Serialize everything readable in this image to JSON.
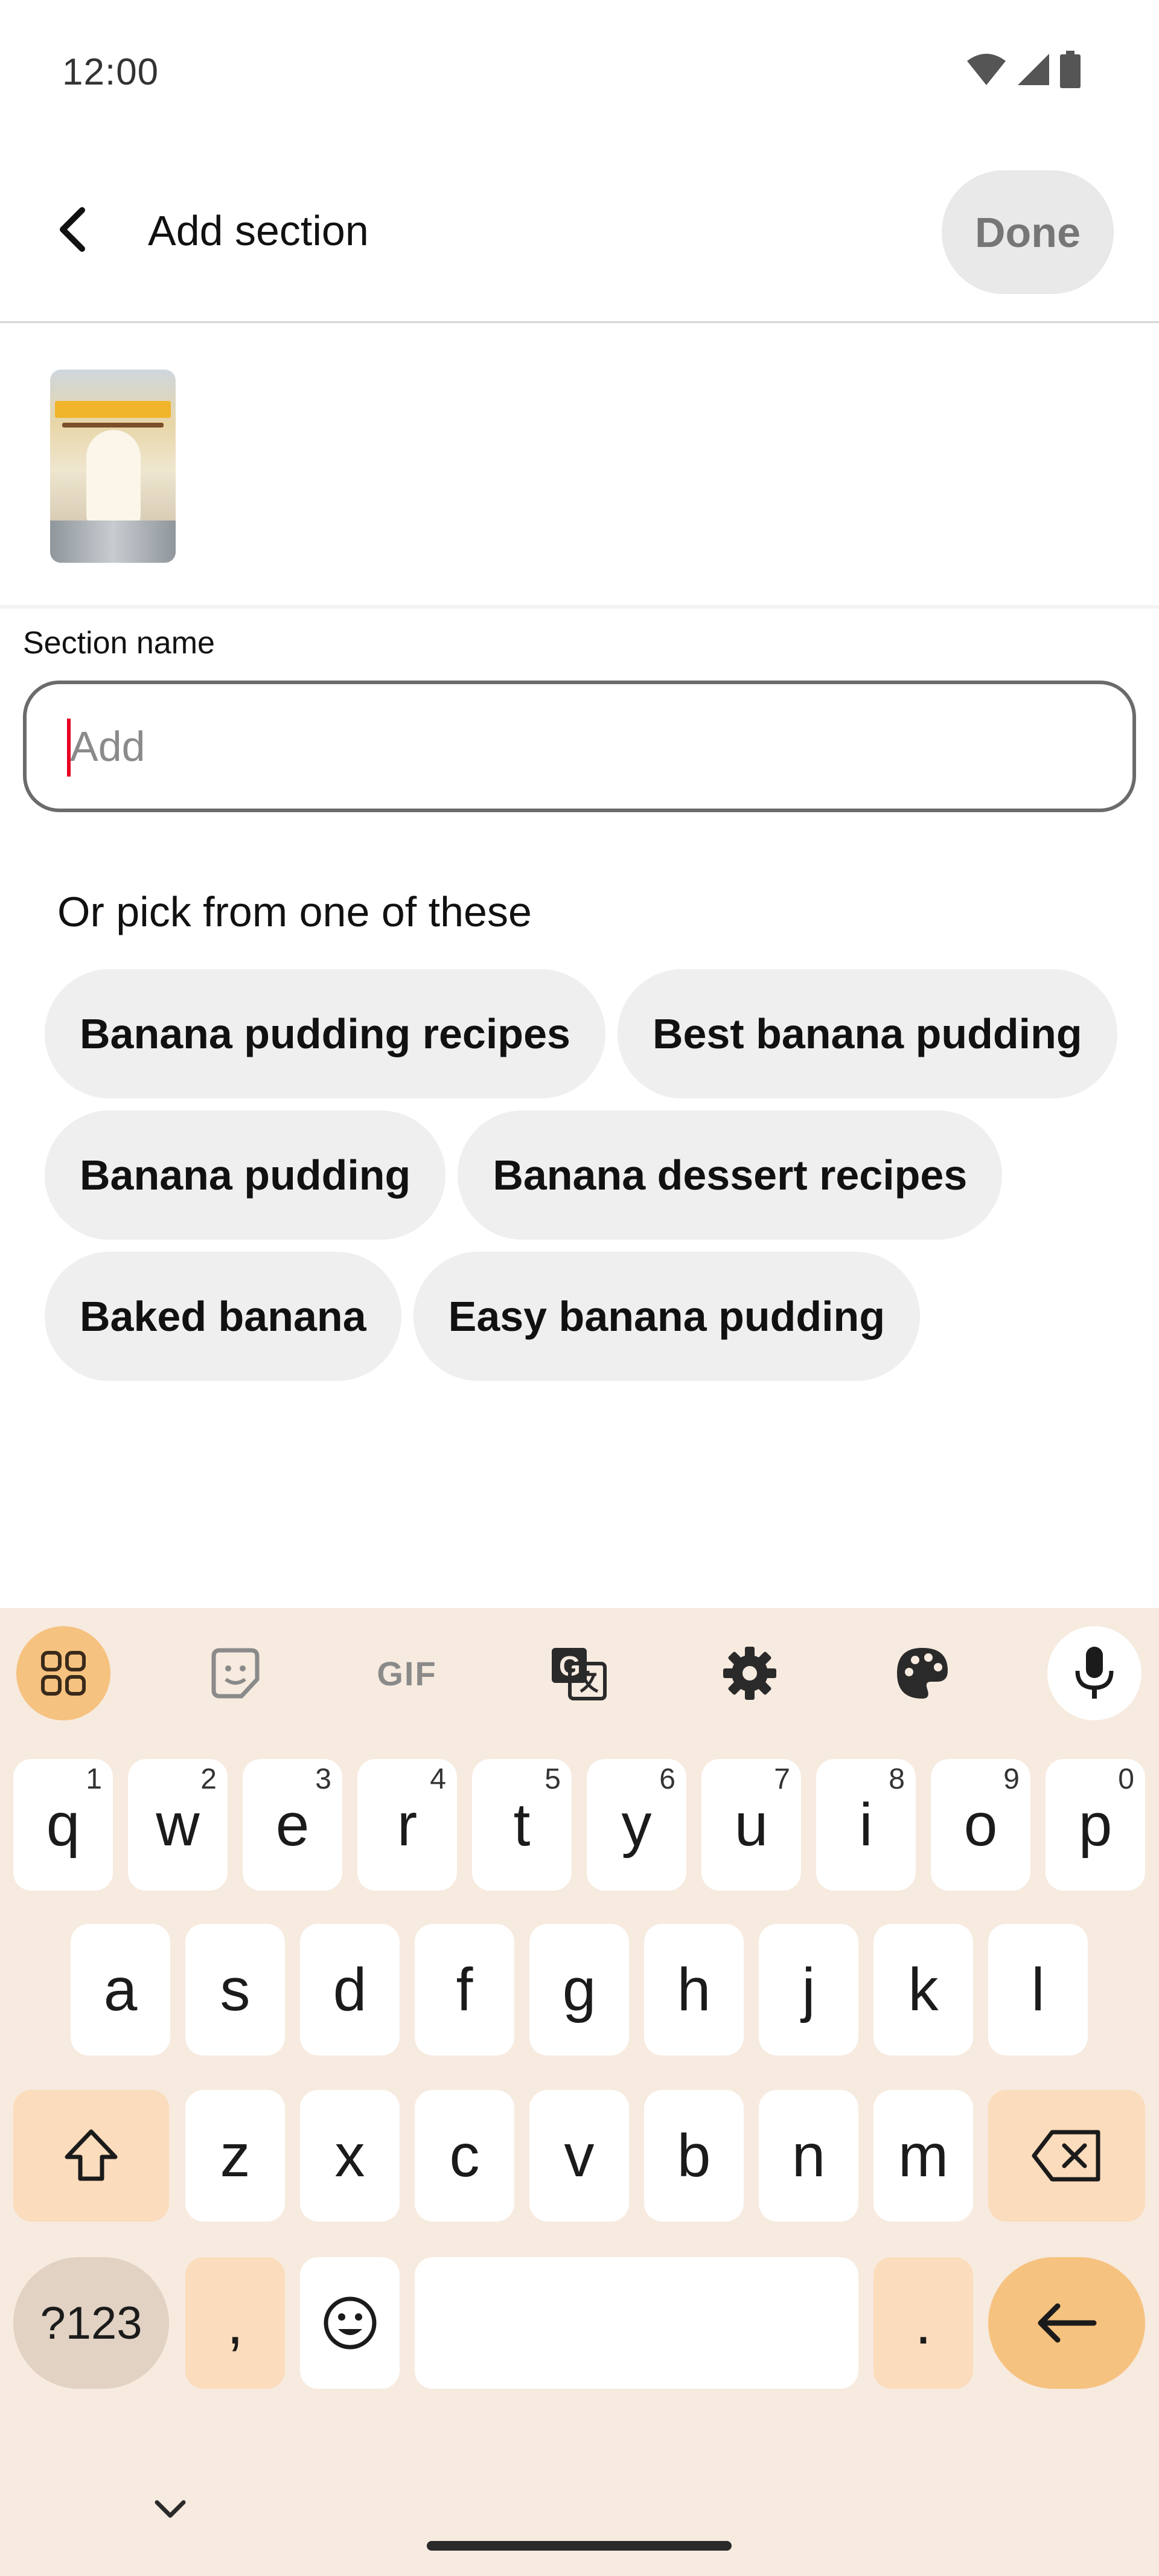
{
  "status_bar": {
    "time": "12:00",
    "icons": [
      "wifi-icon",
      "signal-icon",
      "battery-icon"
    ]
  },
  "header": {
    "title": "Add section",
    "done_label": "Done"
  },
  "pin": {
    "thumbnail_text": "BANANA PUDDING"
  },
  "section_name": {
    "label": "Section name",
    "placeholder": "Add",
    "value": ""
  },
  "suggestions": {
    "title": "Or pick from one of these",
    "items": [
      "Banana pudding recipes",
      "Best banana pudding",
      "Banana pudding",
      "Banana dessert recipes",
      "Baked banana",
      "Easy banana pudding"
    ]
  },
  "keyboard": {
    "toolbar": [
      "apps-grid-icon",
      "sticker-icon",
      "GIF",
      "translate-icon",
      "settings-icon",
      "palette-icon",
      "mic-icon"
    ],
    "gif_label": "GIF",
    "row1": [
      [
        "q",
        "1"
      ],
      [
        "w",
        "2"
      ],
      [
        "e",
        "3"
      ],
      [
        "r",
        "4"
      ],
      [
        "t",
        "5"
      ],
      [
        "y",
        "6"
      ],
      [
        "u",
        "7"
      ],
      [
        "i",
        "8"
      ],
      [
        "o",
        "9"
      ],
      [
        "p",
        "0"
      ]
    ],
    "row2": [
      "a",
      "s",
      "d",
      "f",
      "g",
      "h",
      "j",
      "k",
      "l"
    ],
    "row3": [
      "z",
      "x",
      "c",
      "v",
      "b",
      "n",
      "m"
    ],
    "sym_label": "?123",
    "comma": ",",
    "period": "."
  },
  "colors": {
    "accent": "#e60023",
    "keyboard_bg": "#f7eadf",
    "key_special": "#fbdcbc",
    "key_enter": "#f6c27f"
  }
}
